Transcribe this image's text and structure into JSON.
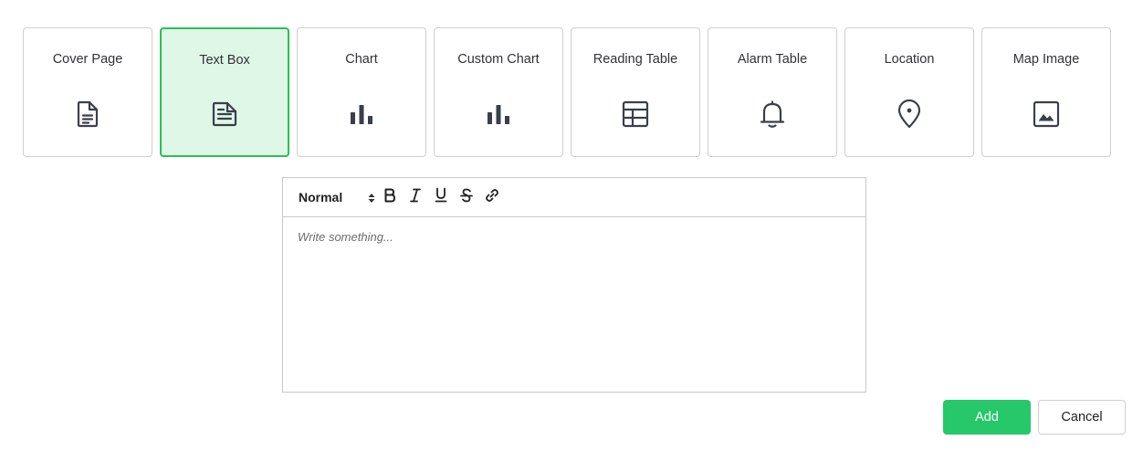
{
  "cards": [
    {
      "label": "Cover Page",
      "icon": "document-icon",
      "selected": false
    },
    {
      "label": "Text Box",
      "icon": "text-document-icon",
      "selected": true
    },
    {
      "label": "Chart",
      "icon": "bar-chart-icon",
      "selected": false
    },
    {
      "label": "Custom Chart",
      "icon": "bar-chart-icon",
      "selected": false
    },
    {
      "label": "Reading Table",
      "icon": "table-icon",
      "selected": false
    },
    {
      "label": "Alarm Table",
      "icon": "bell-icon",
      "selected": false
    },
    {
      "label": "Location",
      "icon": "map-pin-icon",
      "selected": false
    },
    {
      "label": "Map Image",
      "icon": "image-icon",
      "selected": false
    }
  ],
  "colors": {
    "accent": "#26c86a",
    "selected_border": "#2bbf55",
    "selected_bg": "#dff7e7",
    "icon": "#3a3f4a"
  },
  "editor": {
    "format_value": "Normal",
    "placeholder": "Write something...",
    "toolbar_buttons": [
      "bold-icon",
      "italic-icon",
      "underline-icon",
      "strikethrough-icon",
      "link-icon"
    ]
  },
  "actions": {
    "add_label": "Add",
    "cancel_label": "Cancel"
  }
}
